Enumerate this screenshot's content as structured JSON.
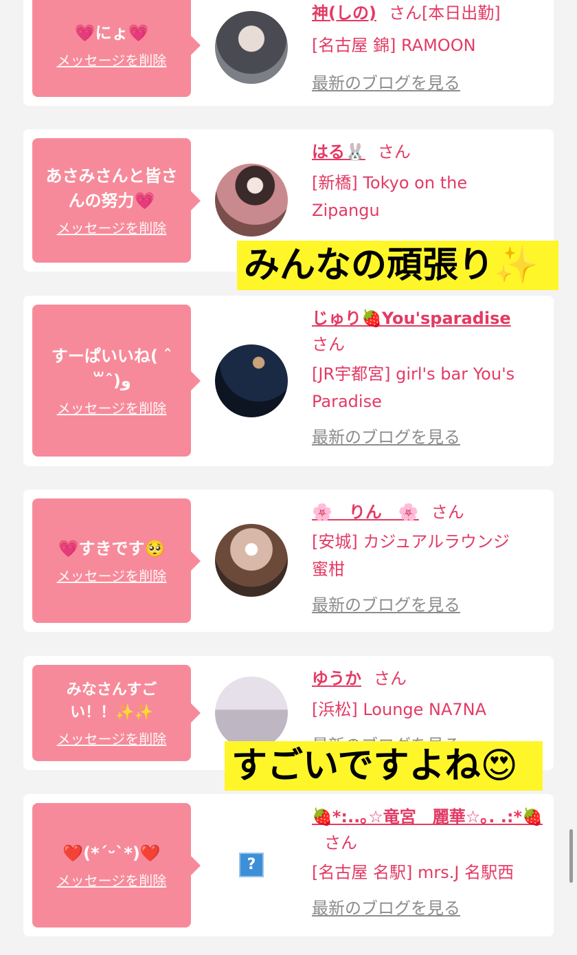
{
  "delete_label": "メッセージを削除",
  "blog_label": "最新のブログを見る",
  "san": "さん",
  "cards": [
    {
      "message": "💗にょ💗",
      "name": "神(しの)",
      "extra": "[本日出勤]",
      "shop": "[名古屋 錦] RAMOON",
      "blog": true
    },
    {
      "message": "あさみさんと皆さんの努力💗",
      "name": "はる🐰",
      "extra": "",
      "shop": "[新橋] Tokyo on the Zipangu",
      "blog": false
    },
    {
      "message": "すーぱいいね( ˆ꒳ˆ)و",
      "name": "じゅり🍓You'sparadise",
      "extra": "",
      "shop": "[JR宇都宮] girl's bar You's Paradise",
      "blog": true
    },
    {
      "message": "💗すきです🥺",
      "name": "🌸　りん　🌸",
      "extra": "",
      "shop": "[安城] カジュアルラウンジ　蜜柑",
      "blog": true
    },
    {
      "message": "みなさんすごい！！✨✨",
      "name": "ゆうか",
      "extra": "",
      "shop": "[浜松] Lounge NA7NA",
      "blog": true
    },
    {
      "message": "❤️(*´ᵕ`*)❤️",
      "name": "🍓*:..｡☆竜宮　麗華☆｡. .:*🍓",
      "extra": "",
      "shop": "[名古屋 名駅] mrs.J 名駅西",
      "blog": true
    }
  ],
  "overlays": {
    "caption1": "みんなの頑張り✨",
    "caption2": "すごいですよね😍"
  },
  "avatar_placeholder": "?",
  "colors": {
    "accent": "#e33a64",
    "bubble": "#f78a9a",
    "highlight": "#fff62a"
  }
}
